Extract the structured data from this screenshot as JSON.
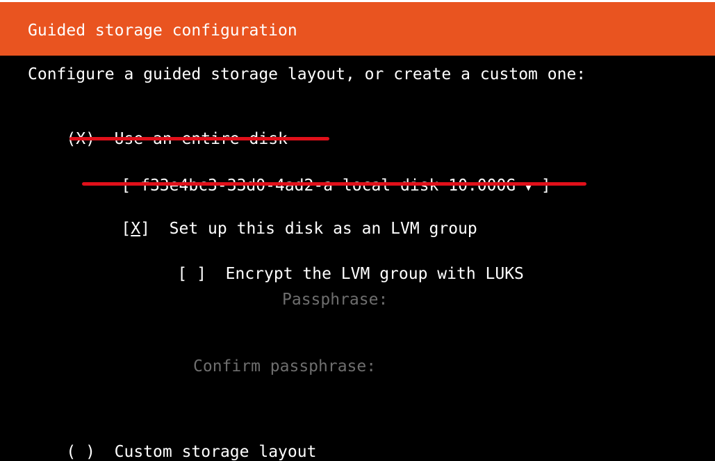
{
  "header": {
    "title": "Guided storage configuration"
  },
  "intro": {
    "text": "Configure a guided storage layout, or create a custom one:"
  },
  "entire_disk_option": {
    "marker": "(X)",
    "label": "Use an entire disk"
  },
  "disk_select": {
    "open": "[",
    "value": "f33e4bc3-33d0-4ad2-a local disk 10.000G",
    "arrow": "▼",
    "close": "]"
  },
  "lvm_option": {
    "open": "[",
    "mark": "X",
    "close": "]",
    "label": "Set up this disk as an LVM group"
  },
  "encrypt_option": {
    "marker": "[ ]",
    "label": "Encrypt the LVM group with LUKS"
  },
  "passphrase": {
    "label": "Passphrase:"
  },
  "confirm_passphrase": {
    "label": "Confirm passphrase:"
  },
  "custom_option": {
    "marker": "( )",
    "label": "Custom storage layout"
  },
  "colors": {
    "header_bg": "#e95420",
    "annotation": "#e0101a",
    "disabled_text": "#6e6e6e"
  }
}
